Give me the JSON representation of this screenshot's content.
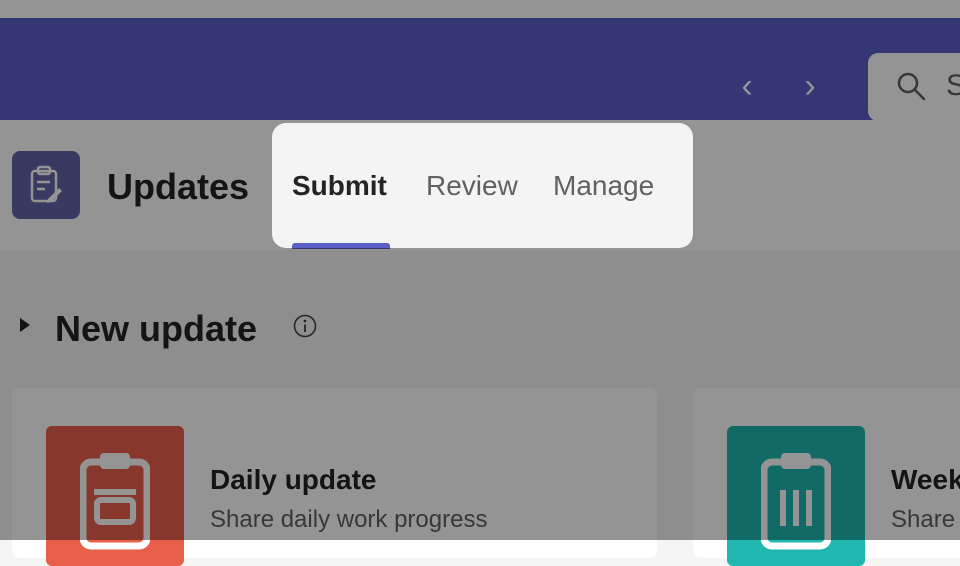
{
  "topbar": {
    "back_icon": "chevron-left-icon",
    "forward_icon": "chevron-right-icon",
    "search": {
      "icon": "search-icon",
      "placeholder": "S"
    }
  },
  "app": {
    "icon": "clipboard-edit-icon",
    "title": "Updates",
    "tabs": [
      {
        "label": "Submit",
        "selected": true
      },
      {
        "label": "Review",
        "selected": false
      },
      {
        "label": "Manage",
        "selected": false
      }
    ]
  },
  "section": {
    "title": "New update",
    "info_icon": "info-icon"
  },
  "cards": [
    {
      "title": "Daily update",
      "description": "Share daily work progress",
      "icon": "clipboard-icon",
      "color": "#e8604a"
    },
    {
      "title": "Week",
      "description": "Share",
      "icon": "clipboard-list-icon",
      "color": "#1fb7b0"
    }
  ],
  "colors": {
    "brand": "#5b5fc7",
    "app_icon": "#6264a7",
    "overlay": "rgba(0,0,0,0.42)"
  }
}
